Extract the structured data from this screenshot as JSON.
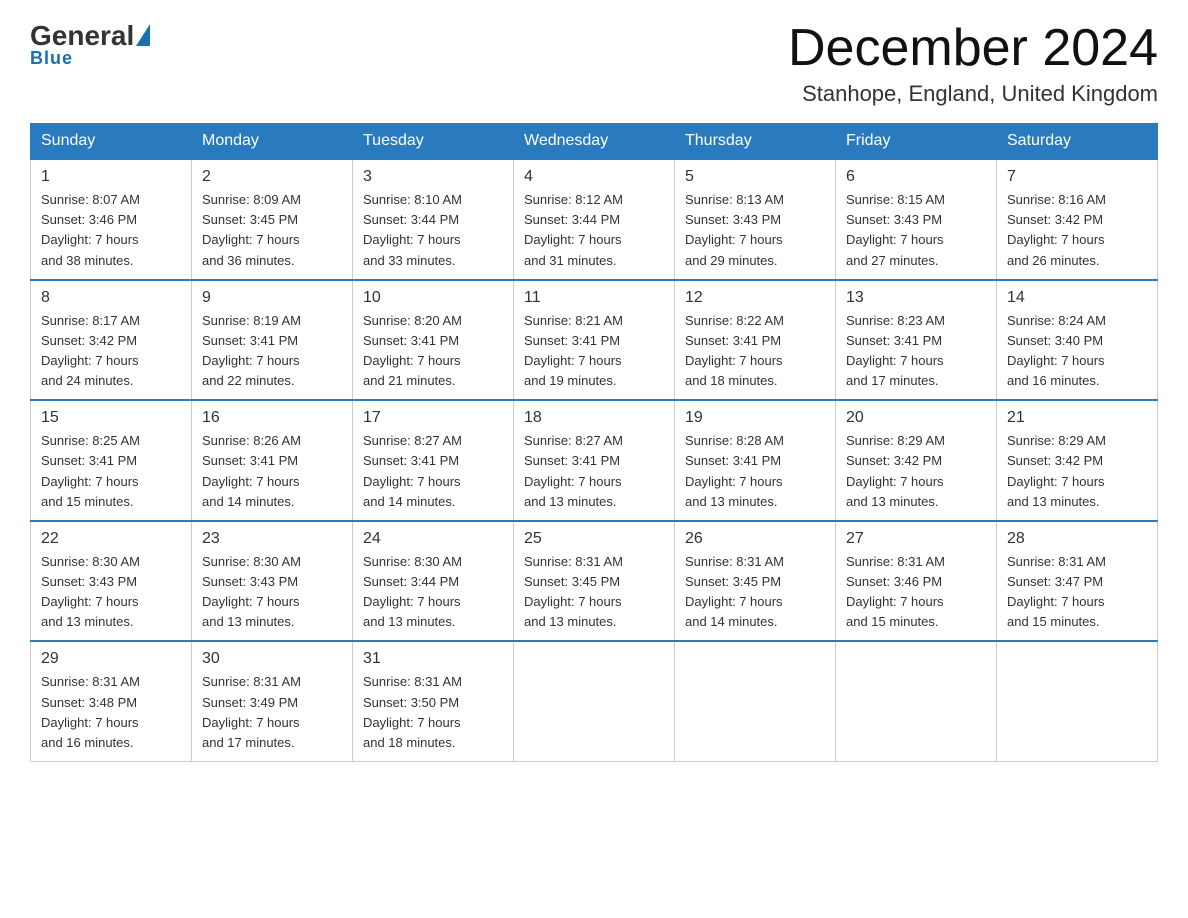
{
  "header": {
    "logo_general": "General",
    "logo_blue": "Blue",
    "month_title": "December 2024",
    "location": "Stanhope, England, United Kingdom"
  },
  "weekdays": [
    "Sunday",
    "Monday",
    "Tuesday",
    "Wednesday",
    "Thursday",
    "Friday",
    "Saturday"
  ],
  "weeks": [
    [
      {
        "day": "1",
        "sunrise": "8:07 AM",
        "sunset": "3:46 PM",
        "daylight": "7 hours and 38 minutes."
      },
      {
        "day": "2",
        "sunrise": "8:09 AM",
        "sunset": "3:45 PM",
        "daylight": "7 hours and 36 minutes."
      },
      {
        "day": "3",
        "sunrise": "8:10 AM",
        "sunset": "3:44 PM",
        "daylight": "7 hours and 33 minutes."
      },
      {
        "day": "4",
        "sunrise": "8:12 AM",
        "sunset": "3:44 PM",
        "daylight": "7 hours and 31 minutes."
      },
      {
        "day": "5",
        "sunrise": "8:13 AM",
        "sunset": "3:43 PM",
        "daylight": "7 hours and 29 minutes."
      },
      {
        "day": "6",
        "sunrise": "8:15 AM",
        "sunset": "3:43 PM",
        "daylight": "7 hours and 27 minutes."
      },
      {
        "day": "7",
        "sunrise": "8:16 AM",
        "sunset": "3:42 PM",
        "daylight": "7 hours and 26 minutes."
      }
    ],
    [
      {
        "day": "8",
        "sunrise": "8:17 AM",
        "sunset": "3:42 PM",
        "daylight": "7 hours and 24 minutes."
      },
      {
        "day": "9",
        "sunrise": "8:19 AM",
        "sunset": "3:41 PM",
        "daylight": "7 hours and 22 minutes."
      },
      {
        "day": "10",
        "sunrise": "8:20 AM",
        "sunset": "3:41 PM",
        "daylight": "7 hours and 21 minutes."
      },
      {
        "day": "11",
        "sunrise": "8:21 AM",
        "sunset": "3:41 PM",
        "daylight": "7 hours and 19 minutes."
      },
      {
        "day": "12",
        "sunrise": "8:22 AM",
        "sunset": "3:41 PM",
        "daylight": "7 hours and 18 minutes."
      },
      {
        "day": "13",
        "sunrise": "8:23 AM",
        "sunset": "3:41 PM",
        "daylight": "7 hours and 17 minutes."
      },
      {
        "day": "14",
        "sunrise": "8:24 AM",
        "sunset": "3:40 PM",
        "daylight": "7 hours and 16 minutes."
      }
    ],
    [
      {
        "day": "15",
        "sunrise": "8:25 AM",
        "sunset": "3:41 PM",
        "daylight": "7 hours and 15 minutes."
      },
      {
        "day": "16",
        "sunrise": "8:26 AM",
        "sunset": "3:41 PM",
        "daylight": "7 hours and 14 minutes."
      },
      {
        "day": "17",
        "sunrise": "8:27 AM",
        "sunset": "3:41 PM",
        "daylight": "7 hours and 14 minutes."
      },
      {
        "day": "18",
        "sunrise": "8:27 AM",
        "sunset": "3:41 PM",
        "daylight": "7 hours and 13 minutes."
      },
      {
        "day": "19",
        "sunrise": "8:28 AM",
        "sunset": "3:41 PM",
        "daylight": "7 hours and 13 minutes."
      },
      {
        "day": "20",
        "sunrise": "8:29 AM",
        "sunset": "3:42 PM",
        "daylight": "7 hours and 13 minutes."
      },
      {
        "day": "21",
        "sunrise": "8:29 AM",
        "sunset": "3:42 PM",
        "daylight": "7 hours and 13 minutes."
      }
    ],
    [
      {
        "day": "22",
        "sunrise": "8:30 AM",
        "sunset": "3:43 PM",
        "daylight": "7 hours and 13 minutes."
      },
      {
        "day": "23",
        "sunrise": "8:30 AM",
        "sunset": "3:43 PM",
        "daylight": "7 hours and 13 minutes."
      },
      {
        "day": "24",
        "sunrise": "8:30 AM",
        "sunset": "3:44 PM",
        "daylight": "7 hours and 13 minutes."
      },
      {
        "day": "25",
        "sunrise": "8:31 AM",
        "sunset": "3:45 PM",
        "daylight": "7 hours and 13 minutes."
      },
      {
        "day": "26",
        "sunrise": "8:31 AM",
        "sunset": "3:45 PM",
        "daylight": "7 hours and 14 minutes."
      },
      {
        "day": "27",
        "sunrise": "8:31 AM",
        "sunset": "3:46 PM",
        "daylight": "7 hours and 15 minutes."
      },
      {
        "day": "28",
        "sunrise": "8:31 AM",
        "sunset": "3:47 PM",
        "daylight": "7 hours and 15 minutes."
      }
    ],
    [
      {
        "day": "29",
        "sunrise": "8:31 AM",
        "sunset": "3:48 PM",
        "daylight": "7 hours and 16 minutes."
      },
      {
        "day": "30",
        "sunrise": "8:31 AM",
        "sunset": "3:49 PM",
        "daylight": "7 hours and 17 minutes."
      },
      {
        "day": "31",
        "sunrise": "8:31 AM",
        "sunset": "3:50 PM",
        "daylight": "7 hours and 18 minutes."
      },
      null,
      null,
      null,
      null
    ]
  ],
  "labels": {
    "sunrise": "Sunrise:",
    "sunset": "Sunset:",
    "daylight": "Daylight:"
  }
}
